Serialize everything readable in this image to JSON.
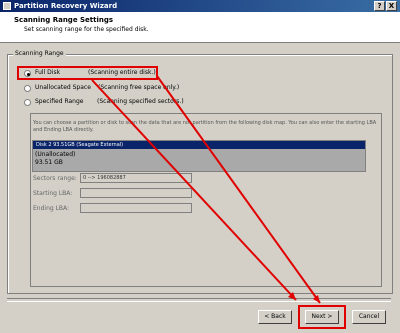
{
  "window": {
    "title": "Partition Recovery Wizard",
    "controls": {
      "help": "?",
      "close": "X"
    }
  },
  "header": {
    "title": "Scanning Range Settings",
    "subtitle": "Set scanning range for the specified disk."
  },
  "scanning_range": {
    "group_label": "Scanning Range",
    "options": [
      {
        "label": "Full Disk",
        "description": "(Scanning entire disk.)",
        "selected": true
      },
      {
        "label": "Unallocated Space",
        "description": "(Scanning free space only.)",
        "selected": false
      },
      {
        "label": "Specified Range",
        "description": "(Scanning specified sectors.)",
        "selected": false
      }
    ],
    "instructions": "You can choose a partition or disk to scan the data that are not partition from the following disk map. You can also enter the starting LBA and Ending LBA directly.",
    "disk": {
      "header": "Disk 2 93.51GB  (Seagate External)",
      "line1": "(Unallocated)",
      "line2": "93.51 GB"
    },
    "fields": {
      "sectors_range": {
        "label": "Sectors range:",
        "value": "0 --> 196082887"
      },
      "starting_lba": {
        "label": "Starting LBA:",
        "value": ""
      },
      "ending_lba": {
        "label": "Ending LBA:",
        "value": ""
      }
    }
  },
  "buttons": {
    "back": "< Back",
    "next": "Next >",
    "cancel": "Cancel"
  },
  "colors": {
    "highlight": "#e00000",
    "titlebar": "#0a246a"
  }
}
